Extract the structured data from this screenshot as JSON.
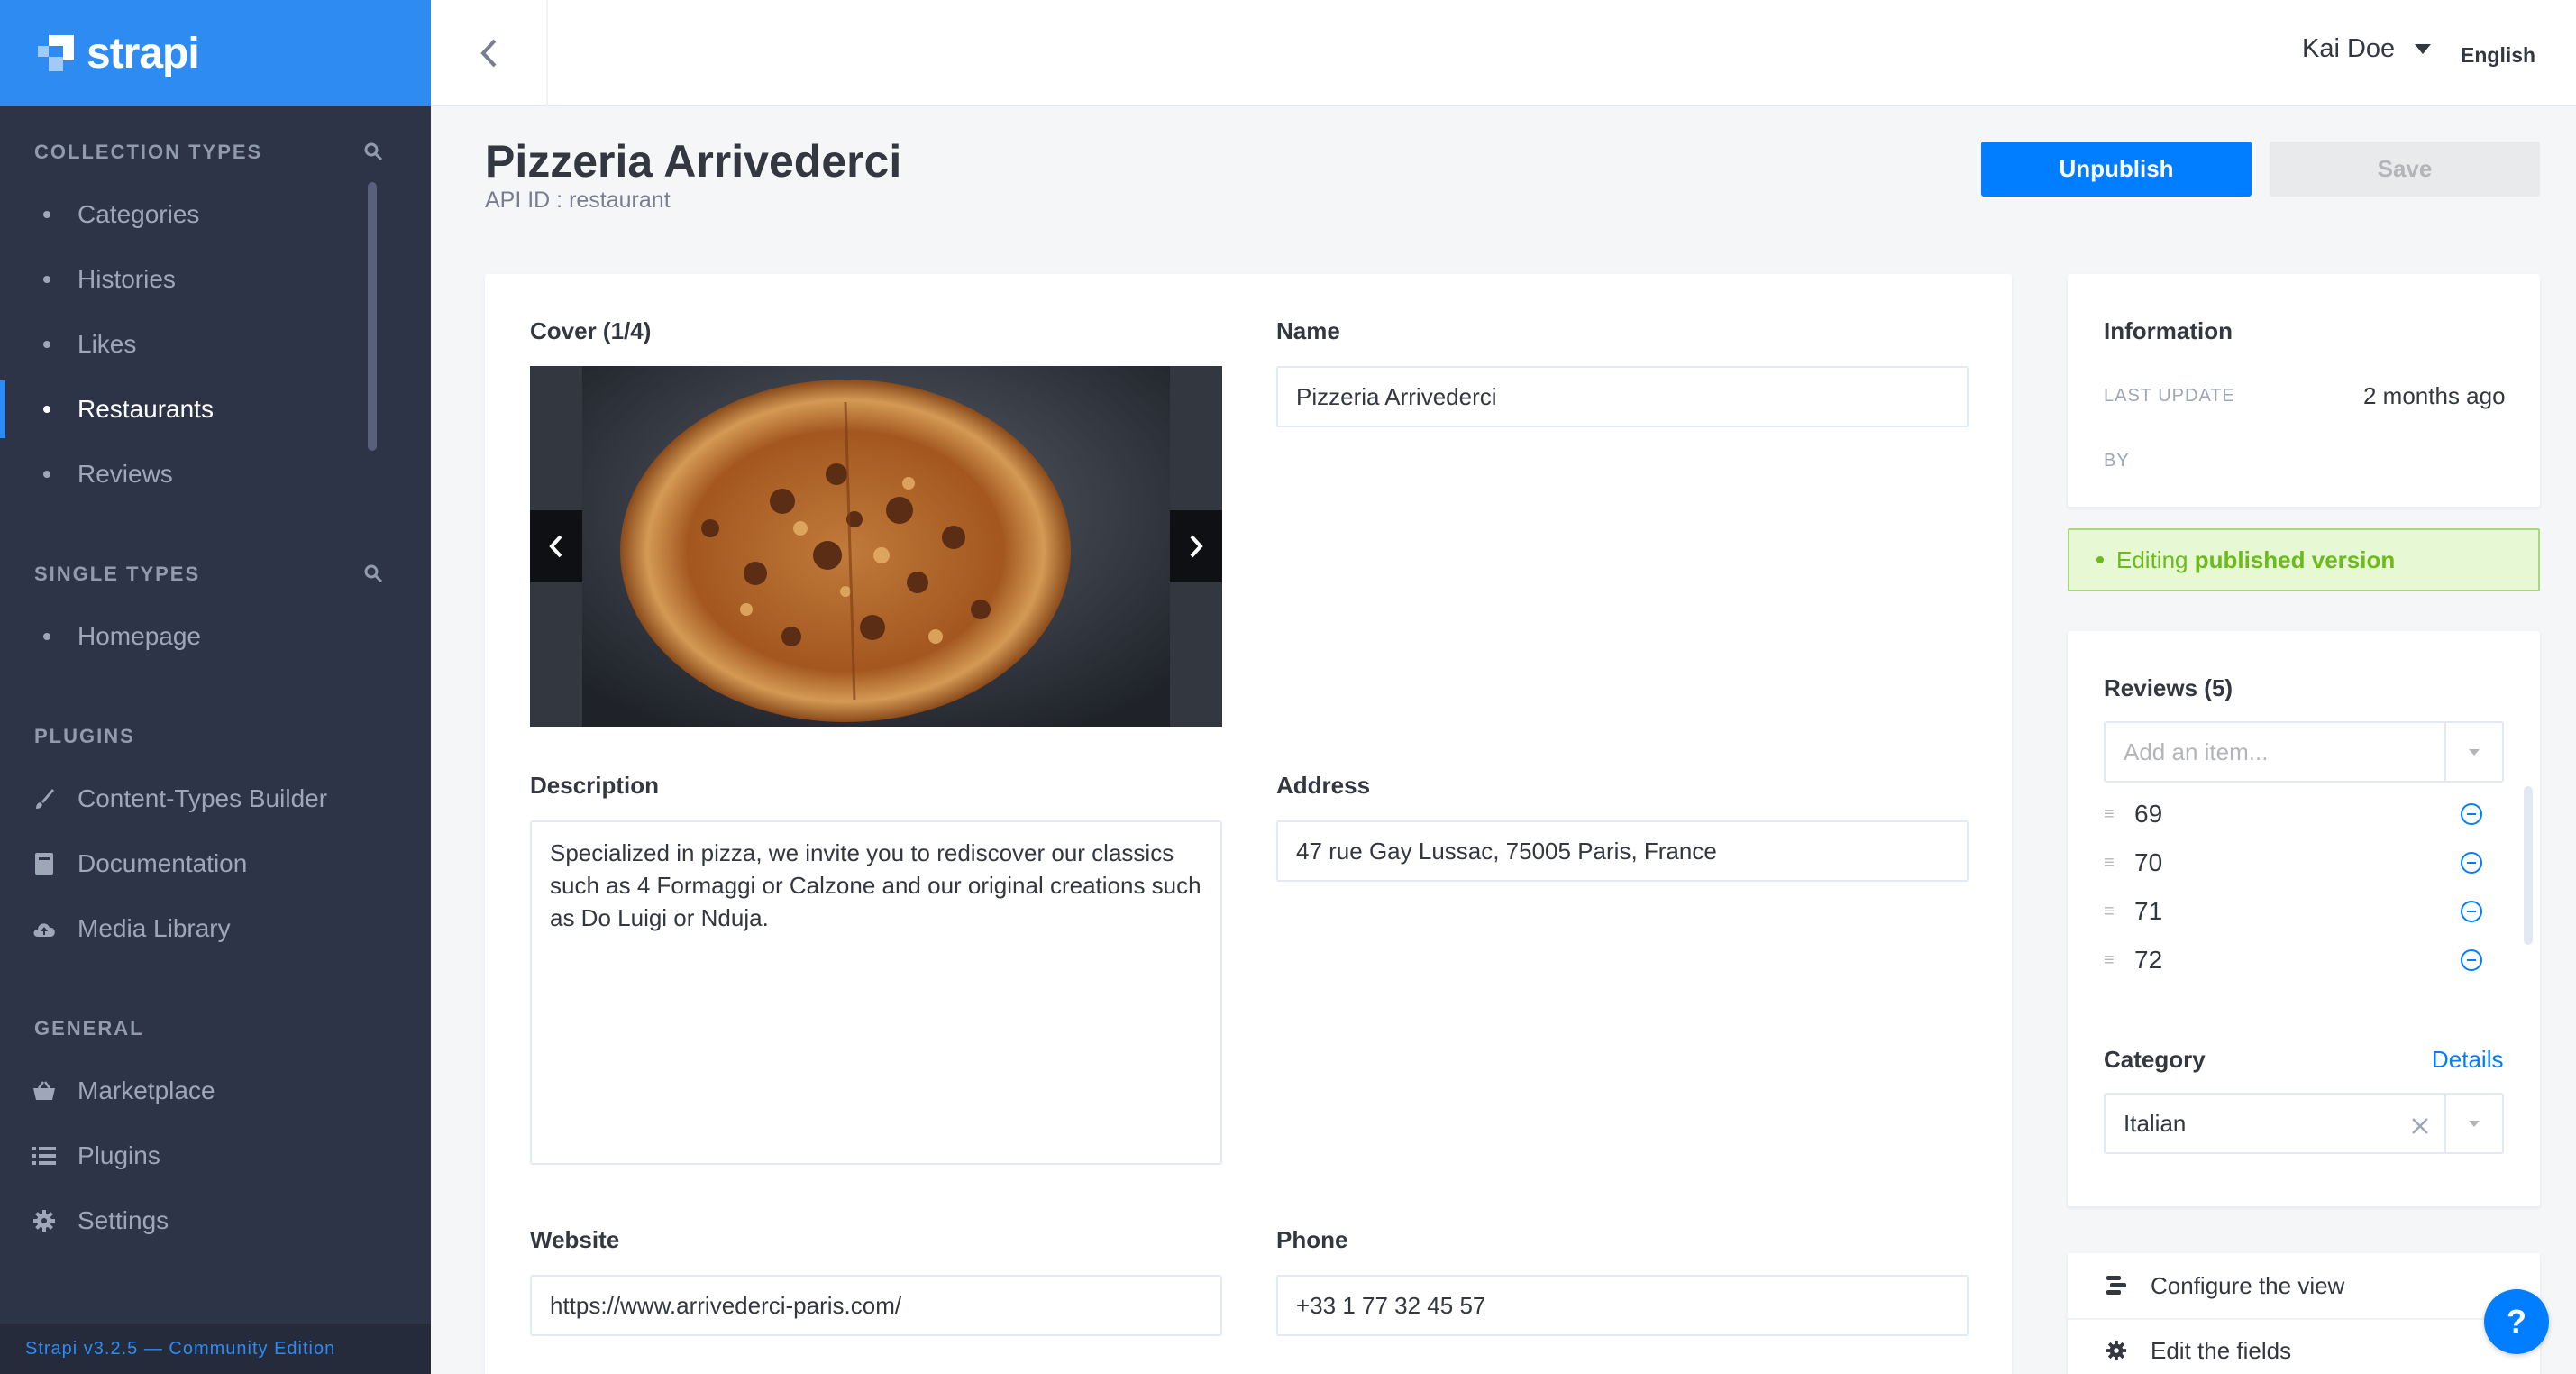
{
  "brand": {
    "name": "strapi",
    "accent": "#2e8bf1"
  },
  "sidebar": {
    "collection_types_heading": "COLLECTION TYPES",
    "collection_types": [
      {
        "label": "Categories",
        "active": false
      },
      {
        "label": "Histories",
        "active": false
      },
      {
        "label": "Likes",
        "active": false
      },
      {
        "label": "Restaurants",
        "active": true
      },
      {
        "label": "Reviews",
        "active": false
      }
    ],
    "single_types_heading": "SINGLE TYPES",
    "single_types": [
      {
        "label": "Homepage"
      }
    ],
    "plugins_heading": "PLUGINS",
    "plugins": [
      {
        "label": "Content-Types Builder",
        "icon": "paint-brush-icon"
      },
      {
        "label": "Documentation",
        "icon": "book-icon"
      },
      {
        "label": "Media Library",
        "icon": "cloud-upload-icon"
      }
    ],
    "general_heading": "GENERAL",
    "general": [
      {
        "label": "Marketplace",
        "icon": "shopping-basket-icon"
      },
      {
        "label": "Plugins",
        "icon": "list-icon"
      },
      {
        "label": "Settings",
        "icon": "gear-icon"
      }
    ],
    "version": "Strapi v3.2.5 — Community Edition"
  },
  "header": {
    "user": "Kai Doe",
    "language": "English"
  },
  "page": {
    "title": "Pizzeria Arrivederci",
    "subtitle": "API ID : restaurant",
    "unpublish_label": "Unpublish",
    "save_label": "Save"
  },
  "form": {
    "cover_label": "Cover (1/4)",
    "name_label": "Name",
    "name_value": "Pizzeria Arrivederci",
    "description_label": "Description",
    "description_value": "Specialized in pizza, we invite you to rediscover our classics such as 4 Formaggi or Calzone and our original creations such as Do Luigi or Nduja.",
    "address_label": "Address",
    "address_value": "47 rue Gay Lussac, 75005 Paris, France",
    "website_label": "Website",
    "website_value": "https://www.arrivederci-paris.com/",
    "phone_label": "Phone",
    "phone_value": "+33 1 77 32 45 57"
  },
  "info": {
    "title": "Information",
    "last_update_key": "LAST UPDATE",
    "last_update_value": "2 months ago",
    "by_key": "BY",
    "status_prefix": "Editing",
    "status_bold": "published version"
  },
  "reviews": {
    "title": "Reviews (5)",
    "placeholder": "Add an item...",
    "items": [
      "69",
      "70",
      "71",
      "72"
    ]
  },
  "category": {
    "title": "Category",
    "details_link": "Details",
    "value": "Italian"
  },
  "actions": {
    "configure": "Configure the view",
    "edit_fields": "Edit the fields"
  },
  "help": "?"
}
